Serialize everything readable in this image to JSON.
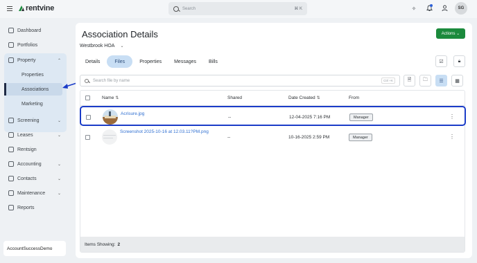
{
  "app": {
    "brand": "rentvine"
  },
  "topbar": {
    "search_placeholder": "Search",
    "search_shortcut": "⌘ K",
    "avatar_initials": "SG"
  },
  "sidebar": {
    "items": [
      {
        "label": "Dashboard",
        "icon": "grid-icon"
      },
      {
        "label": "Portfolios",
        "icon": "folder-icon"
      },
      {
        "label": "Property",
        "icon": "building-icon",
        "expanded": true
      },
      {
        "label": "Screening",
        "icon": "screening-icon"
      },
      {
        "label": "Leases",
        "icon": "lease-icon"
      },
      {
        "label": "Rentsign",
        "icon": "sign-icon"
      },
      {
        "label": "Accounting",
        "icon": "dollar-icon"
      },
      {
        "label": "Contacts",
        "icon": "contacts-icon"
      },
      {
        "label": "Maintenance",
        "icon": "wrench-icon"
      },
      {
        "label": "Reports",
        "icon": "reports-icon"
      }
    ],
    "property_sub": [
      "Properties",
      "Associations",
      "Marketing"
    ],
    "account": "AccountSuccessDemo"
  },
  "main": {
    "title": "Association Details",
    "actions_label": "Actions",
    "association": "Westbrook HOA",
    "tabs": [
      "Details",
      "Files",
      "Properties",
      "Messages",
      "Bills"
    ],
    "active_tab": "Files",
    "file_search_placeholder": "Search file by name",
    "file_search_shortcut": "Ctrl +K",
    "columns": {
      "name": "Name",
      "shared": "Shared",
      "date": "Date Created",
      "from": "From"
    },
    "rows": [
      {
        "name": "Acrisure.jpg",
        "shared": "--",
        "date": "12-04-2025 7:16 PM",
        "from": "Manager"
      },
      {
        "name": "Screenshot 2025-10-16 at 12.03.11?PM.png",
        "shared": "--",
        "date": "10-16-2025 2:59 PM",
        "from": "Manager"
      }
    ],
    "footer_label": "Items Showing:",
    "footer_count": "2"
  },
  "colors": {
    "accent": "#1b8a3c",
    "link": "#2f6fd1",
    "highlight": "#1a3cc8",
    "tab_active": "#c8def4"
  }
}
